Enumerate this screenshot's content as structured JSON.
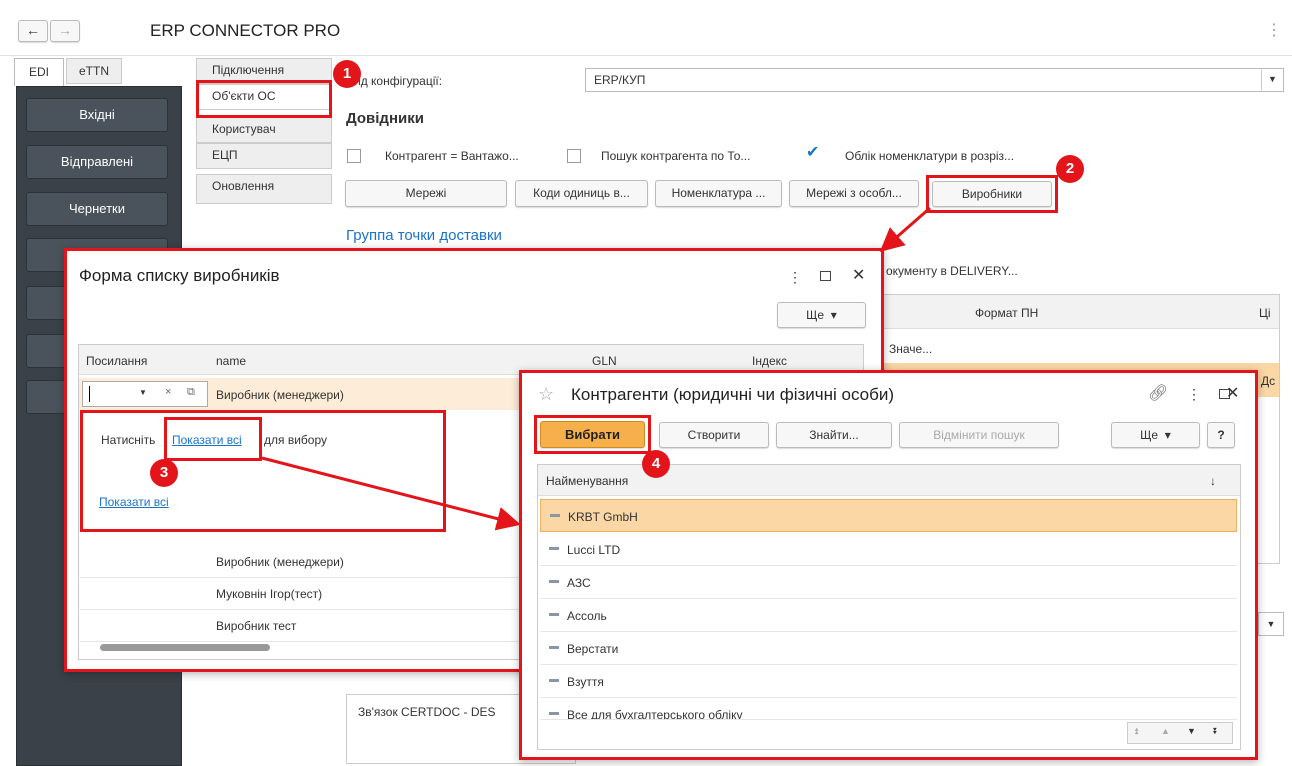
{
  "app": {
    "title": "ERP CONNECTOR PRO"
  },
  "left_tabs": [
    "EDI",
    "eTTN"
  ],
  "sidebar": {
    "items": [
      "Вхідні",
      "Відправлені",
      "Чернетки"
    ]
  },
  "settings_tabs": [
    "Підключення",
    "Об'єкти ОС",
    "Користувач",
    "ЕЦП",
    "Оновлення"
  ],
  "config": {
    "label": "Вид конфігурації:",
    "value": "ERP/КУП"
  },
  "directories": {
    "title": "Довідники",
    "checkboxes": [
      {
        "label": "Контрагент = Вантажо...",
        "checked": false
      },
      {
        "label": "Пошук контрагента по То...",
        "checked": false
      },
      {
        "label": "Облік номенклатури в розріз...",
        "checked": true
      }
    ],
    "buttons": [
      "Мережі",
      "Коди одиниць в...",
      "Номенклатура ...",
      "Мережі з особл...",
      "Виробники"
    ]
  },
  "delivery_group": {
    "title": "Группа точки доставки",
    "doc_text": "окументу в DELIVERY...",
    "table_header": [
      "Формат ПН",
      "Ці"
    ],
    "row_value": "Значе...",
    "row_value2": "Дс"
  },
  "certdoc_label": "Зв'язок CERTDOC - DES",
  "producers_dialog": {
    "title": "Форма списку виробників",
    "more_label": "Ще",
    "columns": [
      "Посилання",
      "name",
      "GLN",
      "Індекс"
    ],
    "current_row_name": "Виробник (менеджери)",
    "hint_prefix": "Натисніть",
    "hint_link": "Показати всі",
    "hint_suffix": "для вибору",
    "show_all_link": "Показати всі",
    "rows": [
      "Виробник (менеджери)",
      "Муковнін Ігор(тест)",
      "Виробник тест"
    ]
  },
  "counterparties_dialog": {
    "title": "Контрагенти (юридичні чи фізичні особи)",
    "buttons": {
      "select": "Вибрати",
      "create": "Створити",
      "find": "Знайти...",
      "cancel_search": "Відмінити пошук",
      "more": "Ще",
      "help": "?"
    },
    "column": "Найменування",
    "rows": [
      "KRBT GmbH",
      "Lucci LTD",
      "АЗС",
      "Ассоль",
      "Верстати",
      "Взуття",
      "Все для бухгалтерського обліку"
    ]
  },
  "badges": [
    "1",
    "2",
    "3",
    "4"
  ],
  "colors": {
    "accent": "#e3151a",
    "sidebar": "#4a535c",
    "highlight": "#fbd7a6",
    "link": "#1a73c8"
  }
}
